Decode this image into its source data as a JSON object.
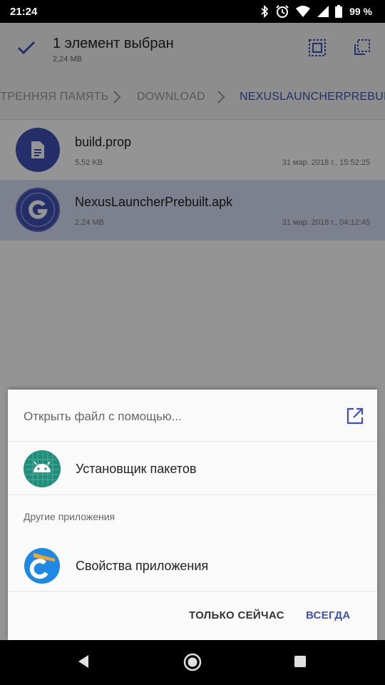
{
  "status_bar": {
    "time": "21:24",
    "battery": "99 %",
    "icons": [
      "bluetooth-icon",
      "alarm-icon",
      "wifi-icon",
      "signal-icon",
      "battery-icon"
    ]
  },
  "app_bar": {
    "title": "1 элемент выбран",
    "subtitle": "2,24 MB"
  },
  "breadcrumb": [
    "УТРЕННЯЯ ПАМЯТЬ",
    "DOWNLOAD",
    "NEXUSLAUNCHERPREBUILT"
  ],
  "files": [
    {
      "name": "build.prop",
      "size": "5,52 KB",
      "date": "31 мар. 2018 г., 15:52:25",
      "selected": false
    },
    {
      "name": "NexusLauncherPrebuilt.apk",
      "size": "2,24 MB",
      "date": "31 мар. 2018 г., 04:12:45",
      "selected": true
    }
  ],
  "dialog": {
    "title": "Открыть файл с помощью...",
    "primary_app": "Установщик пакетов",
    "section_label": "Другие приложения",
    "other_app": "Свойства приложения",
    "button_once": "ТОЛЬКО СЕЙЧАС",
    "button_always": "ВСЕГДА"
  },
  "colors": {
    "accent": "#3f51b5",
    "selected_row": "#d8ddf3",
    "installer_icon_bg": "#1e8e7a",
    "properties_icon_bg": "#1e88e5"
  }
}
